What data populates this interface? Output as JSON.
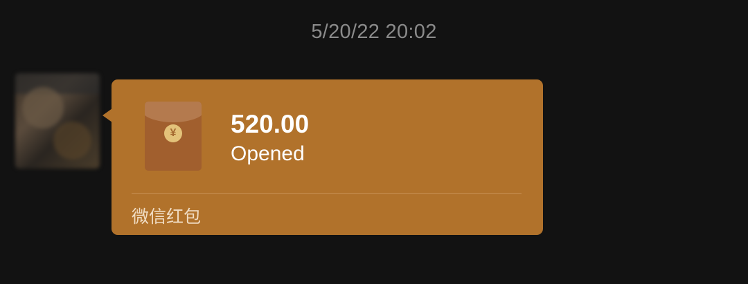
{
  "chat": {
    "timestamp": "5/20/22 20:02"
  },
  "red_packet": {
    "amount": "520.00",
    "status": "Opened",
    "brand_label": "微信红包",
    "seal_glyph": "¥"
  },
  "colors": {
    "background": "#121212",
    "bubble": "#b1722b",
    "envelope": "#a15f2e",
    "timestamp_text": "#8b8b8b"
  },
  "icons": {
    "envelope": "red-packet-envelope-icon"
  }
}
